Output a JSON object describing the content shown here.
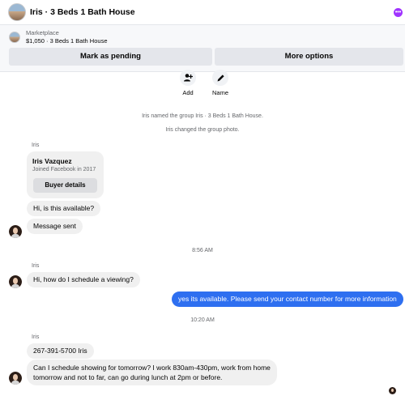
{
  "header": {
    "title": "Iris · 3 Beds 1 Bath House",
    "menu_icon": "more-icon"
  },
  "marketplace": {
    "label": "Marketplace",
    "listing": "$1,050 · 3 Beds 1 Bath House",
    "mark_pending": "Mark as pending",
    "more_options": "More options"
  },
  "actions": {
    "add": "Add",
    "name": "Name"
  },
  "system": {
    "named_group": "Iris named the group Iris · 3 Beds 1 Bath House.",
    "changed_photo": "Iris changed the group photo."
  },
  "messages": {
    "sender": "Iris",
    "card": {
      "name": "Iris Vazquez",
      "joined": "Joined Facebook in 2017",
      "button": "Buyer details"
    },
    "m1": "Hi, is this available?",
    "m2": "Message sent",
    "time1": "8:56 AM",
    "m3": "Hi, how do I schedule a viewing?",
    "out1": "yes its available. Please send your contact number for more information",
    "time2": "10:20 AM",
    "m4": "267-391-5700 Iris",
    "m5_line1": "Can I schedule showing for tomorrow? I work 830am-430pm, work from home",
    "m5_line2": "tomorrow and not to far, can go during lunch  at 2pm or before."
  },
  "colors": {
    "outgoing": "#2e6ff0",
    "incoming": "#f0f0f0",
    "accent": "#a033ff"
  }
}
